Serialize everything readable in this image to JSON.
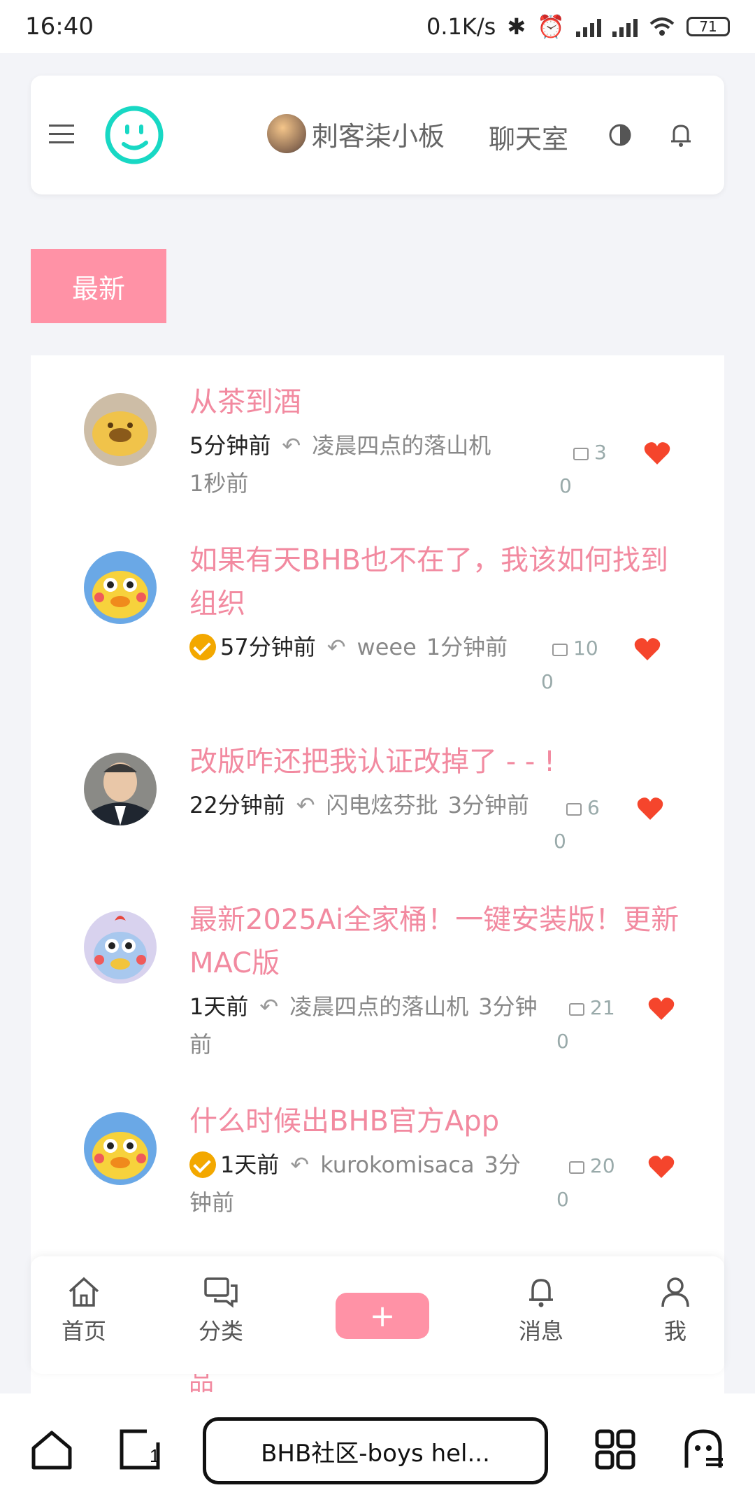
{
  "status": {
    "time": "16:40",
    "speed": "0.1K/s",
    "battery": "71"
  },
  "header": {
    "username": "刺客柒小板",
    "chat": "聊天室"
  },
  "tabs": {
    "latest": "最新"
  },
  "posts": [
    {
      "title": "从茶到酒",
      "time": "5分钟前",
      "replier": "凌晨四点的落山机",
      "reply_time": "1秒前",
      "replies": "3",
      "likes": "0",
      "verified": false
    },
    {
      "title": "如果有天BHB也不在了，我该如何找到组织",
      "time": "57分钟前",
      "replier": "weee",
      "reply_time": "1分钟前",
      "replies": "10",
      "likes": "0",
      "verified": true
    },
    {
      "title": "改版咋还把我认证改掉了 - - !",
      "time": "22分钟前",
      "replier": "闪电炫芬批",
      "reply_time": "3分钟前",
      "replies": "6",
      "likes": "0",
      "verified": false
    },
    {
      "title": "最新2025Ai全家桶！一键安装版！更新MAC版",
      "time": "1天前",
      "replier": "凌晨四点的落山机",
      "reply_time": "3分钟前",
      "replies": "21",
      "likes": "0",
      "verified": false
    },
    {
      "title": "什么时候出BHB官方App",
      "time": "1天前",
      "replier": "kurokomisaca",
      "reply_time": "3分钟前",
      "replies": "20",
      "likes": "0",
      "verified": true
    }
  ],
  "peek_text": "品",
  "tabbar": {
    "home": "首页",
    "category": "分类",
    "add": "+",
    "messages": "消息",
    "me": "我"
  },
  "browser": {
    "url_title": "BHB社区-boys hel..."
  }
}
